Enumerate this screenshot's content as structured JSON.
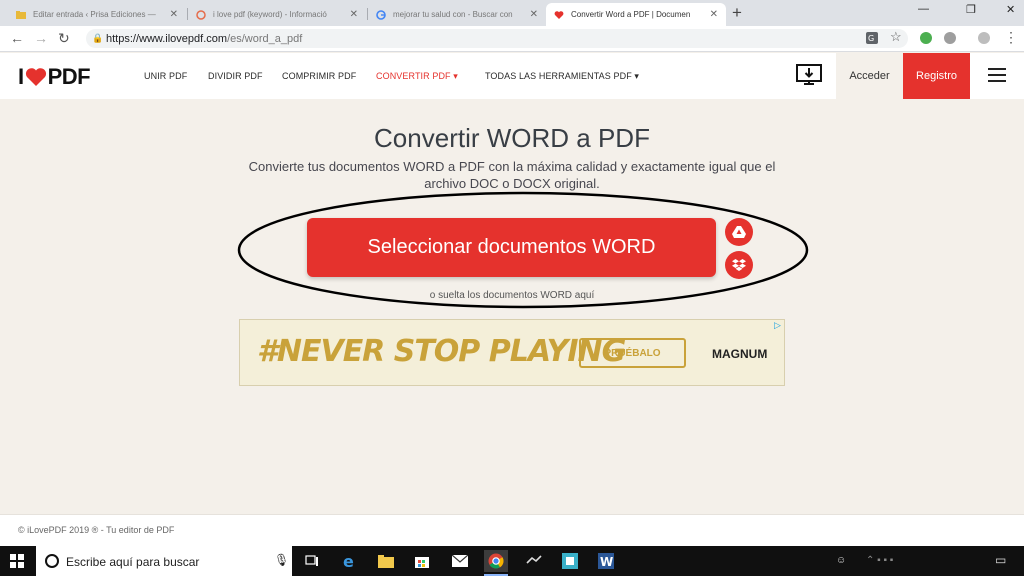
{
  "browser": {
    "tabs": [
      {
        "label": "Editar entrada ‹ Prisa Ediciones — ",
        "favicon": "folder-icon"
      },
      {
        "label": "i love pdf (keyword) - Informació",
        "favicon": "search-tool-icon"
      },
      {
        "label": "mejorar tu salud con - Buscar con",
        "favicon": "google-icon"
      },
      {
        "label": "Convertir Word a PDF | Documen",
        "favicon": "ilovepdf-heart-icon",
        "active": true
      }
    ],
    "url_host": "https://www.ilovepdf.com",
    "url_path": "/es/word_a_pdf"
  },
  "site": {
    "logo_prefix": "I",
    "logo_suffix": "PDF",
    "nav": [
      {
        "label": "UNIR PDF"
      },
      {
        "label": "DIVIDIR PDF"
      },
      {
        "label": "COMPRIMIR PDF"
      },
      {
        "label": "CONVERTIR PDF ▾",
        "active": true
      },
      {
        "label": "TODAS LAS HERRAMIENTAS PDF ▾"
      }
    ],
    "login": "Acceder",
    "register": "Registro"
  },
  "main": {
    "title": "Convertir WORD a PDF",
    "subtitle_line1": "Convierte tus documentos WORD a PDF con la máxima calidad y exactamente igual que el",
    "subtitle_line2": "archivo DOC o DOCX original.",
    "select_button": "Seleccionar documentos WORD",
    "drop_hint": "o suelta los documentos WORD aquí"
  },
  "ad": {
    "slogan": "#NEVER STOP PLAYING",
    "cta": "PRUÉBALO",
    "brand": "MAGNUM"
  },
  "footer": {
    "text": "© iLovePDF 2019 ® - Tu editor de PDF"
  },
  "taskbar": {
    "search_placeholder": "Escribe aquí para buscar"
  },
  "colors": {
    "brand_red": "#e5322d",
    "page_bg": "#f4f0ea"
  }
}
